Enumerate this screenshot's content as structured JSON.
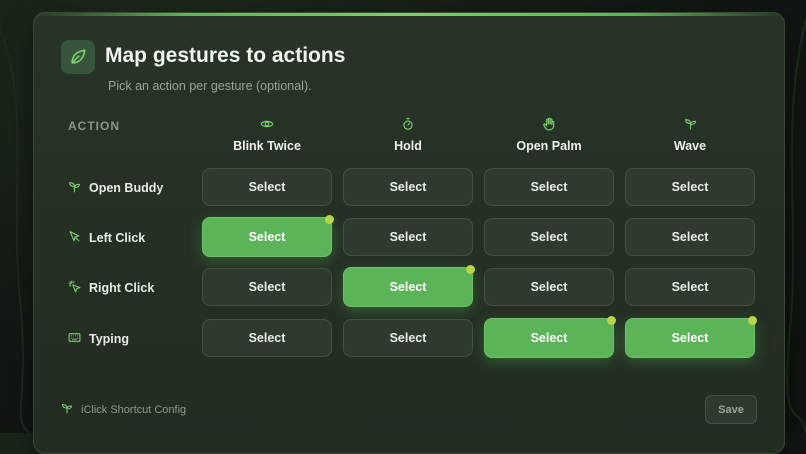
{
  "header": {
    "title": "Map gestures to actions",
    "subtitle": "Pick an action per gesture (optional)."
  },
  "table": {
    "action_header": "ACTION",
    "gestures": [
      {
        "label": "Blink Twice",
        "icon": "eye-icon"
      },
      {
        "label": "Hold",
        "icon": "timer-icon"
      },
      {
        "label": "Open Palm",
        "icon": "hand-icon"
      },
      {
        "label": "Wave",
        "icon": "sprout-icon"
      }
    ],
    "actions": [
      {
        "label": "Open Buddy",
        "icon": "sprout-icon",
        "cells": [
          "Select",
          "Select",
          "Select",
          "Select"
        ],
        "selected": [
          false,
          false,
          false,
          false
        ]
      },
      {
        "label": "Left Click",
        "icon": "cursor-icon",
        "cells": [
          "Select",
          "Select",
          "Select",
          "Select"
        ],
        "selected": [
          true,
          false,
          false,
          false
        ]
      },
      {
        "label": "Right Click",
        "icon": "sparkle-cursor-icon",
        "cells": [
          "Select",
          "Select",
          "Select",
          "Select"
        ],
        "selected": [
          false,
          true,
          false,
          false
        ]
      },
      {
        "label": "Typing",
        "icon": "keyboard-icon",
        "cells": [
          "Select",
          "Select",
          "Select",
          "Select"
        ],
        "selected": [
          false,
          false,
          true,
          true
        ]
      }
    ]
  },
  "footer": {
    "brand": "iClick Shortcut Config",
    "save_label": "Save"
  },
  "colors": {
    "accent": "#5cb458",
    "indicator_dot": "#b7d649",
    "panel": "#252f24"
  }
}
